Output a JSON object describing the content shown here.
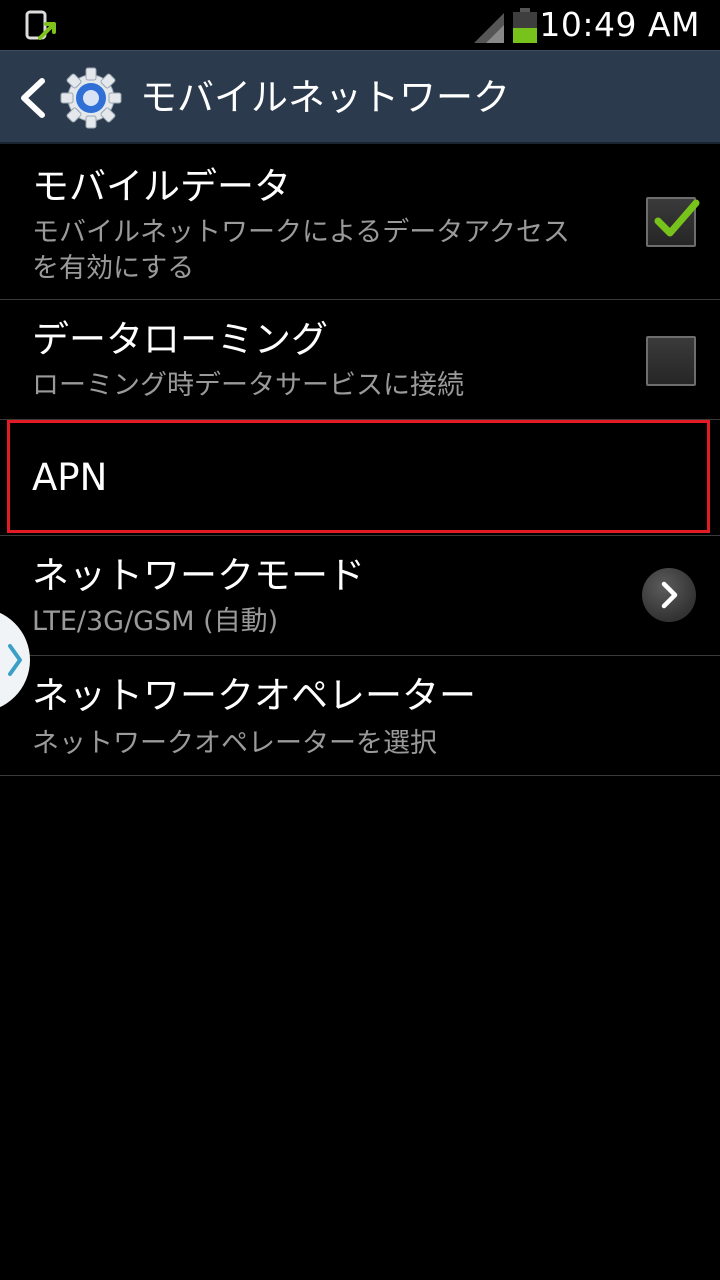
{
  "status_bar": {
    "time": "10:49 AM",
    "icons": [
      "notification-arrow-icon",
      "signal-icon",
      "battery-icon"
    ]
  },
  "action_bar": {
    "title": "モバイルネットワーク",
    "icons": [
      "chevron-left-icon",
      "gear-icon"
    ]
  },
  "settings": [
    {
      "title": "モバイルデータ",
      "summary_line1": "モバイルネットワークによるデータアクセス",
      "summary_line2": "を有効にする",
      "checked": true
    },
    {
      "title": "データローミング",
      "summary_line1": "ローミング時データサービスに接続",
      "checked": false
    },
    {
      "title": "APN"
    },
    {
      "title": "ネットワークモード",
      "summary_line1": "LTE/3G/GSM (自動)"
    },
    {
      "title": "ネットワークオペレーター",
      "summary_line1": "ネットワークオペレーターを選択"
    }
  ],
  "colors": {
    "action_bar": "#2b3a4d",
    "background": "#000000",
    "check_mark": "#78c21c",
    "highlight": "#e21b24",
    "summary_text": "#9a9a9a"
  }
}
